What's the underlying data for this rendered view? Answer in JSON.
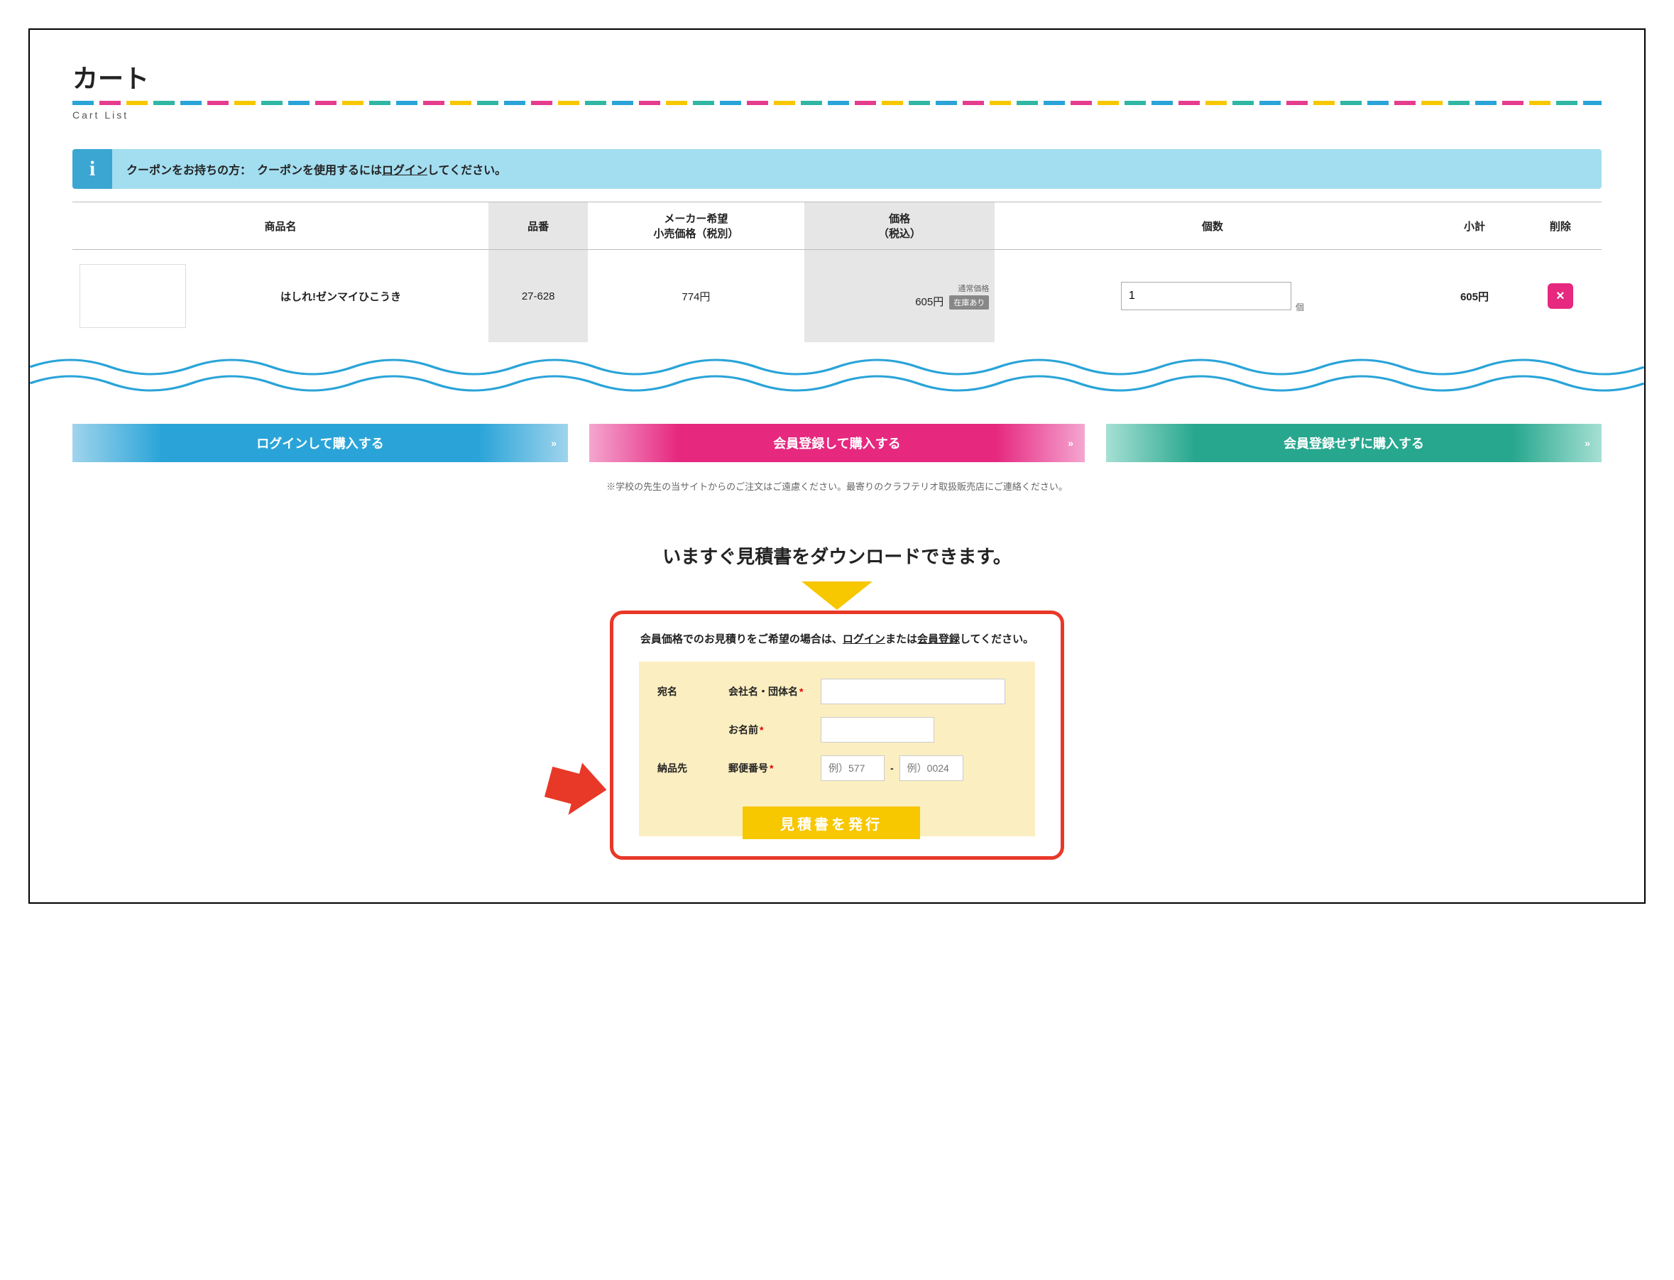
{
  "header": {
    "title": "カート",
    "subtitle": "Cart List"
  },
  "info": {
    "prefix": "クーポンをお持ちの方：　クーポンを使用するには",
    "link": "ログイン",
    "suffix": "してください。"
  },
  "columns": {
    "name": "商品名",
    "code": "品番",
    "msrp": "メーカー希望\n小売価格（税別）",
    "price": "価格\n（税込）",
    "qty": "個数",
    "subtotal": "小計",
    "delete": "削除"
  },
  "item": {
    "name": "はしれ!ゼンマイひこうき",
    "code": "27-628",
    "msrp": "774円",
    "price_label": "通常価格",
    "price": "605円",
    "stock": "在庫あり",
    "qty": "1",
    "qty_unit": "個",
    "subtotal": "605円"
  },
  "actions": {
    "login": "ログインして購入する",
    "register": "会員登録して購入する",
    "guest": "会員登録せずに購入する",
    "note": "※学校の先生の当サイトからのご注文はご遠慮ください。最寄りのクラフテリオ取扱販売店にご連絡ください。"
  },
  "quote": {
    "heading": "いますぐ見積書をダウンロードできます。",
    "note_prefix": "会員価格でのお見積りをご希望の場合は、",
    "note_login": "ログイン",
    "note_mid": "または",
    "note_register": "会員登録",
    "note_suffix": "してください。",
    "section_addressee": "宛名",
    "field_company": "会社名・団体名",
    "field_name": "お名前",
    "section_delivery": "納品先",
    "field_zip": "郵便番号",
    "zip1_placeholder": "例）577",
    "zip2_placeholder": "例）0024",
    "submit": "見積書を発行"
  }
}
